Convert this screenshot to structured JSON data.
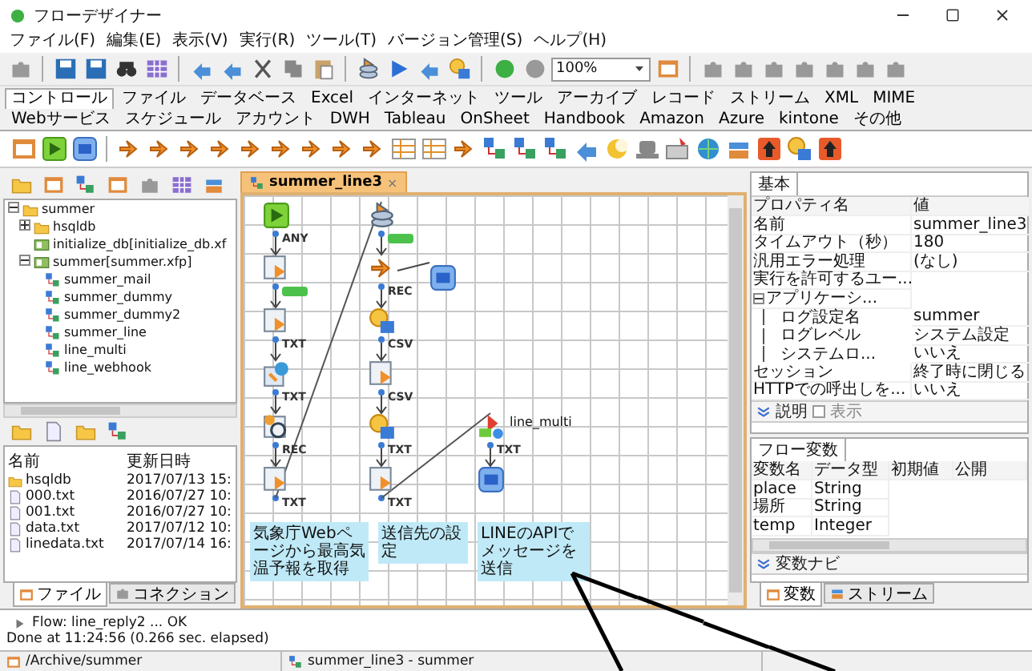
{
  "window": {
    "title": "フローデザイナー"
  },
  "menu": [
    "ファイル(F)",
    "編集(E)",
    "表示(V)",
    "実行(R)",
    "ツール(T)",
    "バージョン管理(S)",
    "ヘルプ(H)"
  ],
  "toolbar": {
    "zoom": "100%"
  },
  "palette_tabs": [
    {
      "label": "コントロール",
      "selected": true
    },
    {
      "label": "ファイル",
      "selected": false
    },
    {
      "label": "データベース",
      "selected": false
    },
    {
      "label": "Excel",
      "selected": false
    },
    {
      "label": "インターネット",
      "selected": false
    },
    {
      "label": "ツール",
      "selected": false
    },
    {
      "label": "アーカイブ",
      "selected": false
    },
    {
      "label": "レコード",
      "selected": false
    },
    {
      "label": "ストリーム",
      "selected": false
    },
    {
      "label": "XML",
      "selected": false
    },
    {
      "label": "MIME",
      "selected": false
    },
    {
      "label": "Webサービス",
      "selected": false
    },
    {
      "label": "スケジュール",
      "selected": false
    },
    {
      "label": "アカウント",
      "selected": false
    },
    {
      "label": "DWH",
      "selected": false
    },
    {
      "label": "Tableau",
      "selected": false
    },
    {
      "label": "OnSheet",
      "selected": false
    },
    {
      "label": "Handbook",
      "selected": false
    },
    {
      "label": "Amazon",
      "selected": false
    },
    {
      "label": "Azure",
      "selected": false
    },
    {
      "label": "kintone",
      "selected": false
    },
    {
      "label": "その他",
      "selected": false
    }
  ],
  "explorer": {
    "tree": [
      {
        "label": "summer",
        "kind": "folder",
        "expanded": true,
        "children": [
          {
            "label": "hsqldb",
            "kind": "folder",
            "expanded": false
          },
          {
            "label": "initialize_db[initialize_db.xf",
            "kind": "project"
          },
          {
            "label": "summer[summer.xfp]",
            "kind": "project",
            "expanded": true,
            "children": [
              {
                "label": "summer_mail",
                "kind": "flow"
              },
              {
                "label": "summer_dummy",
                "kind": "flow"
              },
              {
                "label": "summer_dummy2",
                "kind": "flow"
              },
              {
                "label": "summer_line",
                "kind": "flow"
              },
              {
                "label": "line_multi",
                "kind": "flow"
              },
              {
                "label": "line_webhook",
                "kind": "flow"
              }
            ]
          }
        ]
      }
    ],
    "files": {
      "columns": [
        "名前",
        "更新日時"
      ],
      "rows": [
        {
          "name": "hsqldb",
          "kind": "folder",
          "modified": "2017/07/13 15:"
        },
        {
          "name": "000.txt",
          "kind": "file",
          "modified": "2016/07/27 10:"
        },
        {
          "name": "001.txt",
          "kind": "file",
          "modified": "2016/07/27 10:"
        },
        {
          "name": "data.txt",
          "kind": "file",
          "modified": "2017/07/12 10:"
        },
        {
          "name": "linedata.txt",
          "kind": "file",
          "modified": "2017/07/14 16:"
        }
      ]
    },
    "tabs": [
      {
        "label": "ファイル",
        "selected": true
      },
      {
        "label": "コネクション",
        "selected": false
      }
    ]
  },
  "editor": {
    "tab": {
      "label": "summer_line3",
      "close": "×"
    },
    "columns": [
      {
        "nodes": [
          {
            "kind": "start",
            "link": {
              "kind": "text",
              "label": "ANY"
            }
          },
          {
            "kind": "doc",
            "link": {
              "kind": "tag"
            }
          },
          {
            "kind": "doc",
            "link": {
              "kind": "text",
              "label": "TXT"
            }
          },
          {
            "kind": "web",
            "link": {
              "kind": "text",
              "label": "TXT"
            }
          },
          {
            "kind": "search",
            "link": {
              "kind": "text",
              "label": "REC"
            }
          },
          {
            "kind": "doc",
            "link": {
              "kind": "text",
              "label": "TXT"
            }
          }
        ]
      },
      {
        "nodes": [
          {
            "kind": "db",
            "link": {
              "kind": "tag"
            }
          },
          {
            "kind": "fork",
            "link": {
              "kind": "text",
              "label": "REC"
            },
            "side": {
              "kind": "end"
            }
          },
          {
            "kind": "bulb",
            "link": {
              "kind": "text",
              "label": "CSV"
            }
          },
          {
            "kind": "doc",
            "link": {
              "kind": "text",
              "label": "CSV"
            }
          },
          {
            "kind": "bulb",
            "link": {
              "kind": "text",
              "label": "TXT"
            }
          },
          {
            "kind": "doc",
            "link": {
              "kind": "text",
              "label": "TXT"
            }
          }
        ]
      },
      {
        "nodes": [
          {
            "kind": "multi",
            "name": "line_multi",
            "link": {
              "kind": "text",
              "label": "TXT"
            }
          },
          {
            "kind": "end"
          }
        ]
      }
    ],
    "notes": [
      "気象庁Webページから最高気温予報を取得",
      "送信先の設定",
      "LINEのAPIでメッセージを送信"
    ]
  },
  "properties": {
    "tab": "基本",
    "columns": [
      "プロパティ名",
      "値"
    ],
    "rows": [
      {
        "name": "名前",
        "value": "summer_line3"
      },
      {
        "name": "タイムアウト（秒）",
        "value": "180"
      },
      {
        "name": "汎用エラー処理",
        "value": "(なし)"
      },
      {
        "name": "実行を許可するユー..."
      },
      {
        "name": "アプリケーシ...",
        "expanded": true,
        "children": [
          {
            "name": "ログ設定名",
            "value": "summer"
          },
          {
            "name": "ログレベル",
            "value": "システム設定"
          },
          {
            "name": "システムロ...",
            "value": "いいえ"
          }
        ]
      },
      {
        "name": "セッション",
        "value": "終了時に閉じる"
      },
      {
        "name": "HTTPでの呼出しを...",
        "value": "いいえ"
      }
    ]
  },
  "description": {
    "label": "説明",
    "show_label": "表示",
    "show": false
  },
  "flow_variables": {
    "tab": "フロー変数",
    "columns": [
      "変数名",
      "データ型",
      "初期値",
      "公開"
    ],
    "rows": [
      {
        "name": "place",
        "type": "String"
      },
      {
        "name": "場所",
        "type": "String"
      },
      {
        "name": "temp",
        "type": "Integer"
      }
    ]
  },
  "variable_navi": {
    "label": "変数ナビ"
  },
  "right_tabs": [
    {
      "label": "変数",
      "selected": true
    },
    {
      "label": "ストリーム",
      "selected": false
    }
  ],
  "log": [
    "Flow: line_reply2 ... OK",
    "Done at 11:24:56 (0.266 sec. elapsed)"
  ],
  "status": [
    "/Archive/summer",
    "summer_line3 - summer"
  ]
}
